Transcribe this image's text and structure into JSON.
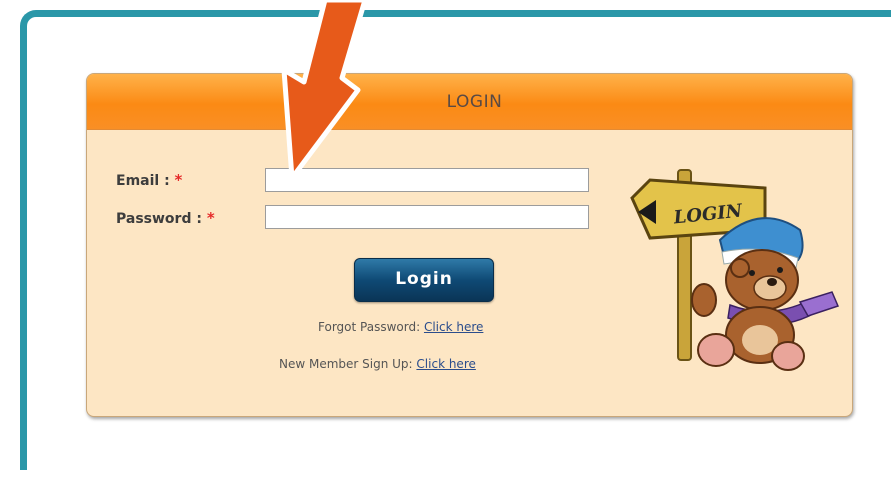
{
  "login": {
    "title": "LOGIN",
    "email_label": "Email :",
    "password_label": "Password :",
    "required_mark": "*",
    "email_value": "",
    "password_value": "",
    "button_label": "Login",
    "forgot_text": "Forgot Password:",
    "forgot_link": "Click here",
    "signup_text": "New Member Sign Up:",
    "signup_link": "Click here",
    "sign_text": "LOGIN"
  },
  "icons": {
    "arrow": "arrow-down-icon",
    "mascot": "bear-mascot-icon"
  },
  "colors": {
    "frame": "#2a97a8",
    "header": "#fb8a14",
    "panel_bg": "#fde6c4",
    "button": "#0f4a75",
    "arrow": "#e75a1a",
    "link": "#2b4d8c",
    "required": "#e52a2a"
  }
}
